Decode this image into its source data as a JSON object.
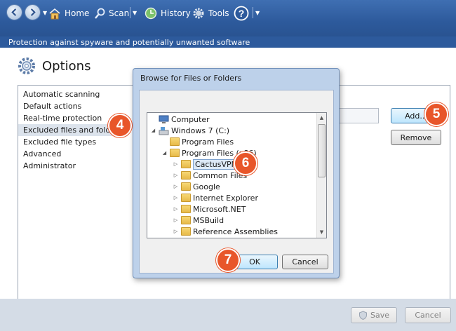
{
  "toolbar": {
    "home_label": "Home",
    "scan_label": "Scan",
    "history_label": "History",
    "tools_label": "Tools"
  },
  "tagline": "Protection against spyware and potentially unwanted software",
  "options": {
    "title": "Options",
    "nav_items": [
      "Automatic scanning",
      "Default actions",
      "Real-time protection",
      "Excluded files and folders",
      "Excluded file types",
      "Advanced",
      "Administrator"
    ],
    "add_label": "Add...",
    "remove_label": "Remove"
  },
  "footer": {
    "save_label": "Save",
    "cancel_label": "Cancel"
  },
  "dialog": {
    "title": "Browse for Files or Folders",
    "tree": [
      "Computer",
      "Windows 7 (C:)",
      "Program Files",
      "Program Files (x86)",
      "CactusVPN",
      "Common Files",
      "Google",
      "Internet Explorer",
      "Microsoft.NET",
      "MSBuild",
      "Reference Assemblies"
    ],
    "ok_label": "OK",
    "cancel_label": "Cancel"
  },
  "badges": [
    "4",
    "5",
    "6",
    "7"
  ],
  "colors": {
    "toolbar_blue": "#2d5a9c",
    "badge_orange": "#e8562a",
    "selection_blue": "#dce9f7"
  }
}
